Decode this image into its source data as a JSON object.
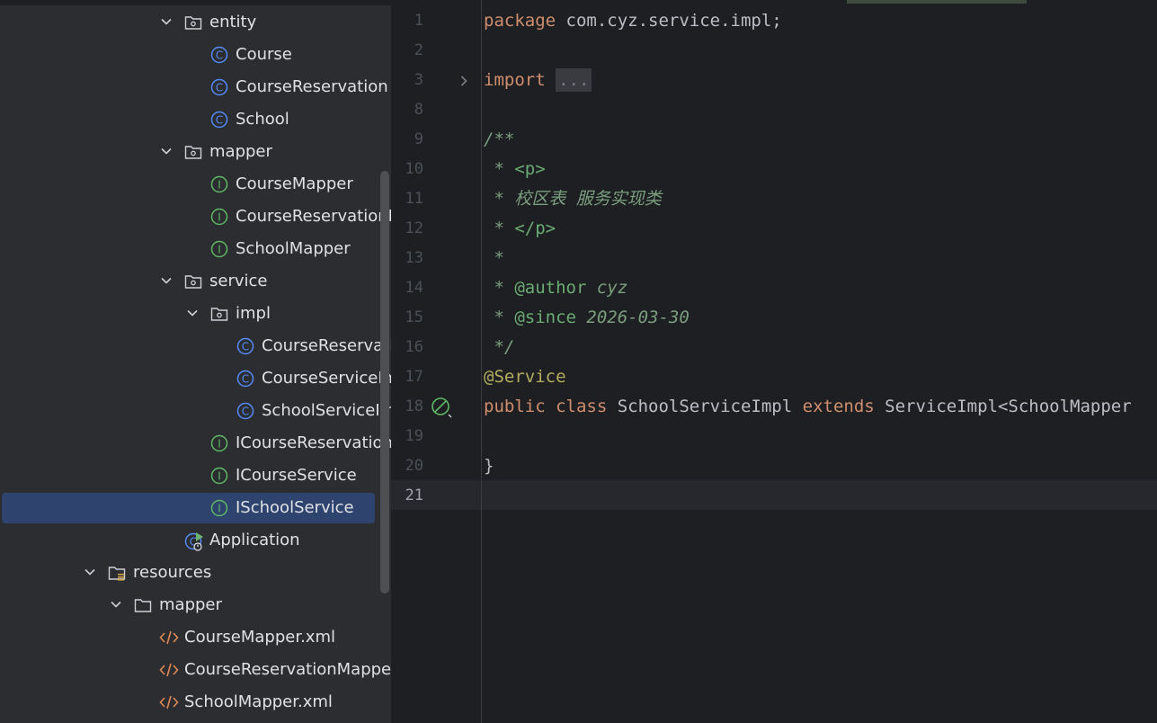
{
  "tree": {
    "rows": [
      {
        "label": "entity",
        "icon": "package-folder",
        "chevron": "down",
        "indent": 1
      },
      {
        "label": "Course",
        "icon": "class",
        "chevron": "",
        "indent": 2
      },
      {
        "label": "CourseReservation",
        "icon": "class",
        "chevron": "",
        "indent": 2
      },
      {
        "label": "School",
        "icon": "class",
        "chevron": "",
        "indent": 2
      },
      {
        "label": "mapper",
        "icon": "package-folder",
        "chevron": "down",
        "indent": 1
      },
      {
        "label": "CourseMapper",
        "icon": "interface",
        "chevron": "",
        "indent": 2
      },
      {
        "label": "CourseReservationM",
        "icon": "interface",
        "chevron": "",
        "indent": 2
      },
      {
        "label": "SchoolMapper",
        "icon": "interface",
        "chevron": "",
        "indent": 2
      },
      {
        "label": "service",
        "icon": "package-folder",
        "chevron": "down",
        "indent": 1
      },
      {
        "label": "impl",
        "icon": "package-folder",
        "chevron": "down",
        "indent": 2
      },
      {
        "label": "CourseReservatic",
        "icon": "class",
        "chevron": "",
        "indent": 3
      },
      {
        "label": "CourseServiceImp",
        "icon": "class",
        "chevron": "",
        "indent": 3
      },
      {
        "label": "SchoolServiceImp",
        "icon": "class",
        "chevron": "",
        "indent": 3
      },
      {
        "label": "ICourseReservationS",
        "icon": "interface",
        "chevron": "",
        "indent": 2
      },
      {
        "label": "ICourseService",
        "icon": "interface",
        "chevron": "",
        "indent": 2
      },
      {
        "label": "ISchoolService",
        "icon": "interface",
        "chevron": "",
        "indent": 2,
        "selected": true
      },
      {
        "label": "Application",
        "icon": "spring-boot-app",
        "chevron": "",
        "indent": 1
      },
      {
        "label": "resources",
        "icon": "resources-folder",
        "chevron": "down",
        "indent": -2
      },
      {
        "label": "mapper",
        "icon": "folder",
        "chevron": "down",
        "indent": -1
      },
      {
        "label": "CourseMapper.xml",
        "icon": "xml-file",
        "chevron": "",
        "indent": 0
      },
      {
        "label": "CourseReservationMapper.",
        "icon": "xml-file",
        "chevron": "",
        "indent": 0
      },
      {
        "label": "SchoolMapper.xml",
        "icon": "xml-file",
        "chevron": "",
        "indent": 0
      }
    ]
  },
  "editor": {
    "current_line": "21",
    "lines": [
      {
        "n": "1",
        "tokens": [
          {
            "t": "package ",
            "c": "kw"
          },
          {
            "t": "com.cyz.service.impl;",
            "c": ""
          }
        ]
      },
      {
        "n": "2",
        "tokens": []
      },
      {
        "n": "3",
        "tokens": [
          {
            "t": "import ",
            "c": "kw"
          },
          {
            "t": "...",
            "c": "fold"
          }
        ],
        "fold": true
      },
      {
        "n": "8",
        "tokens": []
      },
      {
        "n": "9",
        "tokens": [
          {
            "t": "/**",
            "c": "cm"
          }
        ]
      },
      {
        "n": "10",
        "tokens": [
          {
            "t": " * ",
            "c": "cm"
          },
          {
            "t": "<p>",
            "c": "tag"
          }
        ]
      },
      {
        "n": "11",
        "tokens": [
          {
            "t": " * 校区表 服务实现类",
            "c": "cm"
          }
        ]
      },
      {
        "n": "12",
        "tokens": [
          {
            "t": " * ",
            "c": "cm"
          },
          {
            "t": "</p>",
            "c": "tag"
          }
        ]
      },
      {
        "n": "13",
        "tokens": [
          {
            "t": " *",
            "c": "cm"
          }
        ]
      },
      {
        "n": "14",
        "tokens": [
          {
            "t": " * ",
            "c": "cm"
          },
          {
            "t": "@author",
            "c": "tag"
          },
          {
            "t": " cyz",
            "c": "cm"
          }
        ]
      },
      {
        "n": "15",
        "tokens": [
          {
            "t": " * ",
            "c": "cm"
          },
          {
            "t": "@since",
            "c": "tag"
          },
          {
            "t": " 2026-03-30",
            "c": "cm"
          }
        ]
      },
      {
        "n": "16",
        "tokens": [
          {
            "t": " */",
            "c": "cm"
          }
        ]
      },
      {
        "n": "17",
        "tokens": [
          {
            "t": "@Service",
            "c": "ann"
          }
        ]
      },
      {
        "n": "18",
        "tokens": [
          {
            "t": "public ",
            "c": "kw"
          },
          {
            "t": "class ",
            "c": "kw"
          },
          {
            "t": "SchoolServiceImpl ",
            "c": ""
          },
          {
            "t": "extends ",
            "c": "kw"
          },
          {
            "t": "ServiceImpl<SchoolMapper",
            "c": ""
          }
        ],
        "bean": true
      },
      {
        "n": "19",
        "tokens": []
      },
      {
        "n": "20",
        "tokens": [
          {
            "t": "}",
            "c": ""
          }
        ]
      },
      {
        "n": "21",
        "tokens": []
      }
    ]
  },
  "colors": {
    "class_icon": "#548af7",
    "interface_icon": "#5fb865",
    "xml_icon": "#e08855",
    "folder_icon": "#ced0d6",
    "spring_icon": "#6ab26f"
  }
}
